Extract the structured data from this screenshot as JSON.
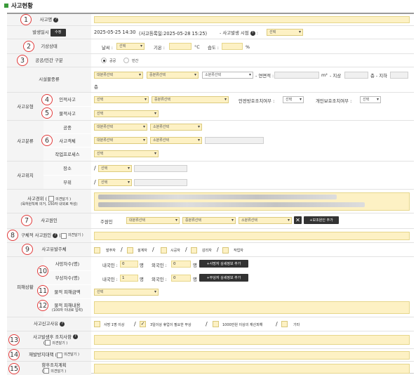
{
  "section_title": "사고현황",
  "rows": {
    "accident_name": {
      "label": "사고명"
    },
    "occurred": {
      "label": "발생일시",
      "edit_btn": "수정",
      "datetime": "2025-05-25 14:30",
      "registered": "(사고등록일:2025-05-28 15:25)",
      "time_label": "- 사고발생 시점",
      "time_select": "선택"
    },
    "weather": {
      "label": "기상상태",
      "weather_lbl": "날씨 :",
      "weather_sel": "선택",
      "temp_lbl": "기온 :",
      "temp_unit": "°C",
      "hum_lbl": "습도 :",
      "hum_unit": "%"
    },
    "ownership": {
      "label": "공공/민간 구분",
      "opt1": "공공",
      "opt2": "민간",
      "selected": "공공"
    },
    "facility": {
      "label": "시설물종류",
      "sel1": "대분류선택",
      "sel2": "중분류선택",
      "sel3": "소분류선택",
      "area_lbl": "- 연면적 :",
      "area_unit": "m²",
      "above_lbl": "- 지상",
      "below_lbl": "층 - 지하",
      "floor_unit": "층"
    },
    "type": {
      "label": "사고유형",
      "human_lbl": "인적사고",
      "human_sel1": "선택",
      "human_sel2": "중분류선택",
      "safety_lbl": "안전방호조치여부 :",
      "safety_sel": "선택",
      "personal_lbl": "개인보호조치여부 :",
      "personal_sel": "선택",
      "material_lbl": "물적사고",
      "material_sel": "선택"
    },
    "classification": {
      "label": "사고분류",
      "work_lbl": "공종",
      "work_sel1": "대분류선택",
      "work_sel2": "소분류선택",
      "object_lbl": "사고객체",
      "object_sel1": "대분류선택",
      "object_sel2": "소분류선택",
      "process_lbl": "작업프로세스",
      "process_sel": "선택"
    },
    "location": {
      "label": "사고위치",
      "place_lbl": "장소",
      "place_sel": "선택",
      "part_lbl": "부위",
      "part_sel": "선택"
    },
    "progress": {
      "label": "사고경위 (",
      "opinion": "의견달기 )",
      "note": "(육하원칙에 의거, 150자 내외로 작성)"
    },
    "cause": {
      "label": "사고원인",
      "main_lbl": "주원인",
      "sel1": "대분류선택",
      "sel2": "중분류선택",
      "sel3": "소분류선택",
      "add_btn": "+보조원인 추가"
    },
    "specific_cause": {
      "label": "구체적 사고원인",
      "opinion": "의견달기 )"
    },
    "subject": {
      "label": "사고유발주체",
      "opts": [
        "발주자",
        "설계자",
        "시공자",
        "감리자",
        "작업자"
      ]
    },
    "damage": {
      "label": "피해상황",
      "death_lbl": "사망자수(명)",
      "domestic_lbl": "내국인 :",
      "foreign_lbl": "외국인 :",
      "death_domestic": "0",
      "death_foreign": "0",
      "unit": "명",
      "death_btn": "+사망자 상세정보 추가",
      "injury_lbl": "부상자수(명)",
      "injury_domestic": "1",
      "injury_foreign": "0",
      "injury_btn": "+부상자 상세정보 추가",
      "amount_lbl": "물적 피해금액",
      "amount_sel": "선택",
      "detail_lbl": "물적 피해내용",
      "detail_note": "(100자 이내로 입력)"
    },
    "report_reason": {
      "label": "사고신고사유",
      "opts": [
        "사망 1명 이상",
        "3일이상 휴업이 필요한 부상",
        "1000만원 이상의 재산피해",
        "기타"
      ],
      "checked": "3일이상 휴업이 필요한 부상"
    },
    "measure": {
      "label": "사고발생후 조치사항",
      "opinion": "의견달기 )"
    },
    "prevention": {
      "label": "재발방지대책",
      "opinion": "의견달기 )"
    },
    "plan": {
      "label": "향후조치계획",
      "opinion": "의견달기 )"
    }
  },
  "colors": {
    "input_bg": "#fdf1c4",
    "marker": "#e23b3b",
    "section_square": "#3a9a3a"
  }
}
